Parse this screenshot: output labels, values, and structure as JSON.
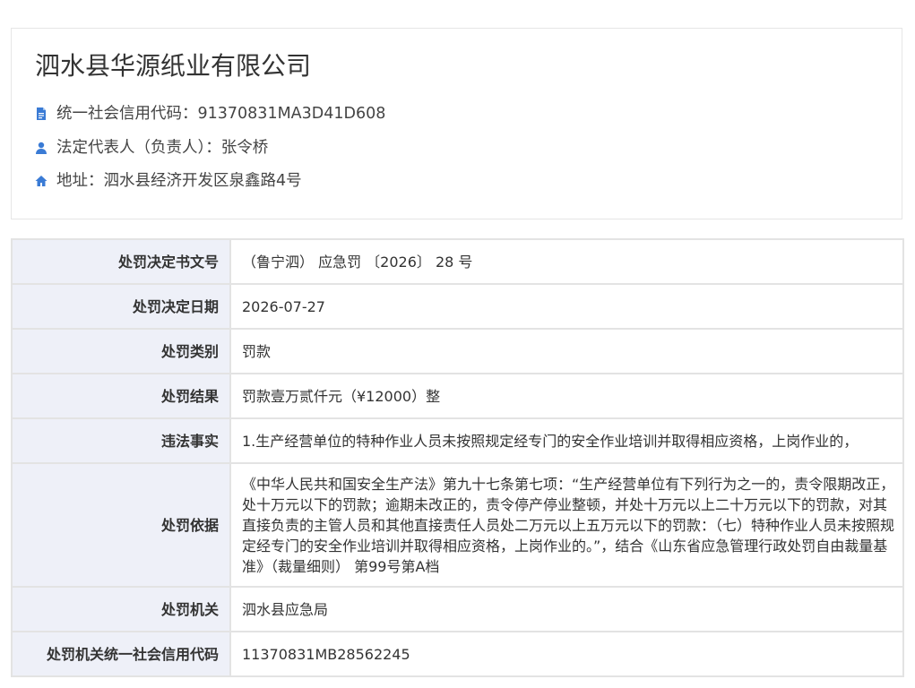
{
  "company": {
    "name": "泗水县华源纸业有限公司",
    "credit_code_label": "统一社会信用代码：",
    "credit_code": "91370831MA3D41D608",
    "legal_rep_label": "法定代表人（负责人）：",
    "legal_rep": "张令桥",
    "address_label": "地址：",
    "address": "泗水县经济开发区泉鑫路4号",
    "icons": [
      "document-icon",
      "user-icon",
      "home-icon"
    ],
    "icon_color": "#3a7bd5"
  },
  "penalty": {
    "rows": [
      {
        "label": "处罚决定书文号",
        "value": "（鲁宁泗） 应急罚 〔2026〕 28 号"
      },
      {
        "label": "处罚决定日期",
        "value": "2026-07-27"
      },
      {
        "label": "处罚类别",
        "value": "罚款"
      },
      {
        "label": "处罚结果",
        "value": "罚款壹万贰仟元（¥12000）整"
      },
      {
        "label": "违法事实",
        "value": "1.生产经营单位的特种作业人员未按照规定经专门的安全作业培训并取得相应资格，上岗作业的，"
      },
      {
        "label": "处罚依据",
        "value": "《中华人民共和国安全生产法》第九十七条第七项：“生产经营单位有下列行为之一的，责令限期改正，处十万元以下的罚款；逾期未改正的，责令停产停业整顿，并处十万元以上二十万元以下的罚款，对其直接负责的主管人员和其他直接责任人员处二万元以上五万元以下的罚款：（七）特种作业人员未按照规定经专门的安全作业培训并取得相应资格，上岗作业的。”，结合《山东省应急管理行政处罚自由裁量基准》（裁量细则） 第99号第A档"
      },
      {
        "label": "处罚机关",
        "value": "泗水县应急局"
      },
      {
        "label": "处罚机关统一社会信用代码",
        "value": "11370831MB28562245"
      }
    ],
    "header_bg": "#eef0f8",
    "border_color": "#e3e3e3"
  }
}
